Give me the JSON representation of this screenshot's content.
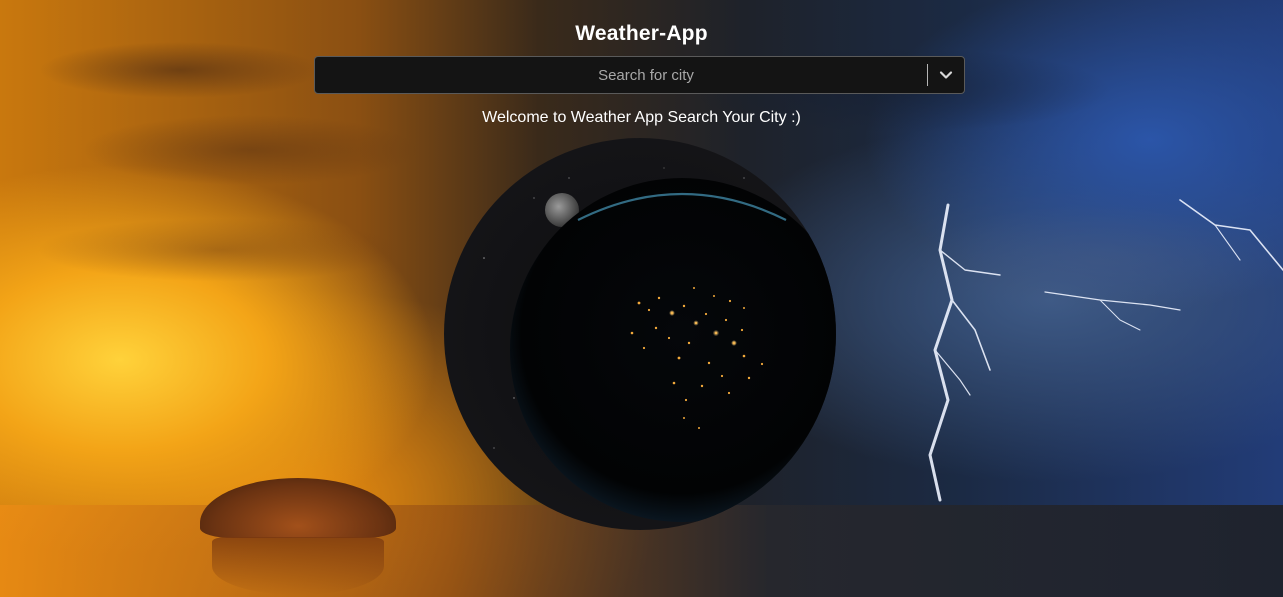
{
  "app": {
    "title": "Weather-App"
  },
  "search": {
    "placeholder": "Search for city",
    "value": ""
  },
  "welcome": {
    "message": "Welcome to Weather App Search Your City :)"
  },
  "icons": {
    "dropdown": "chevron-down-icon",
    "globe": "earth-at-night-icon"
  },
  "colors": {
    "search_bg": "#141414",
    "search_border": "#5a5a5a",
    "text": "#ffffff"
  }
}
